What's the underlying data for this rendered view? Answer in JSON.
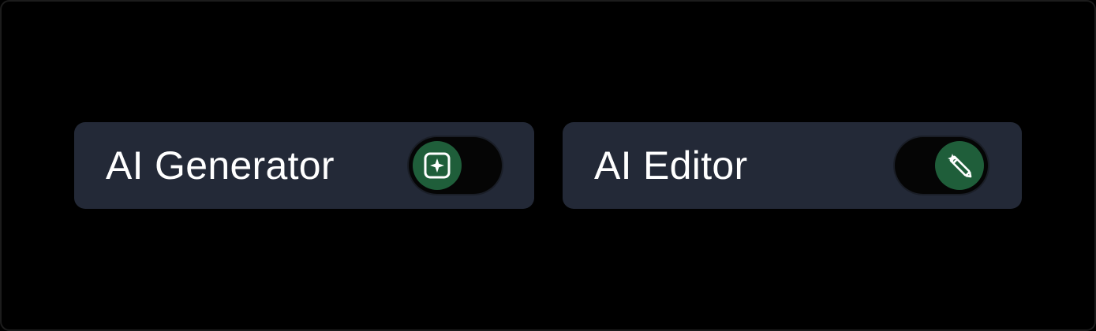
{
  "colors": {
    "background": "#000000",
    "card": "#232937",
    "track": "#050505",
    "knob": "#1f5e3a",
    "text": "#ffffff"
  },
  "toggles": [
    {
      "label": "AI Generator",
      "state": "off",
      "knob_position": "left",
      "icon": "sparkle-image-icon"
    },
    {
      "label": "AI Editor",
      "state": "on",
      "knob_position": "right",
      "icon": "magic-wand-icon"
    }
  ]
}
